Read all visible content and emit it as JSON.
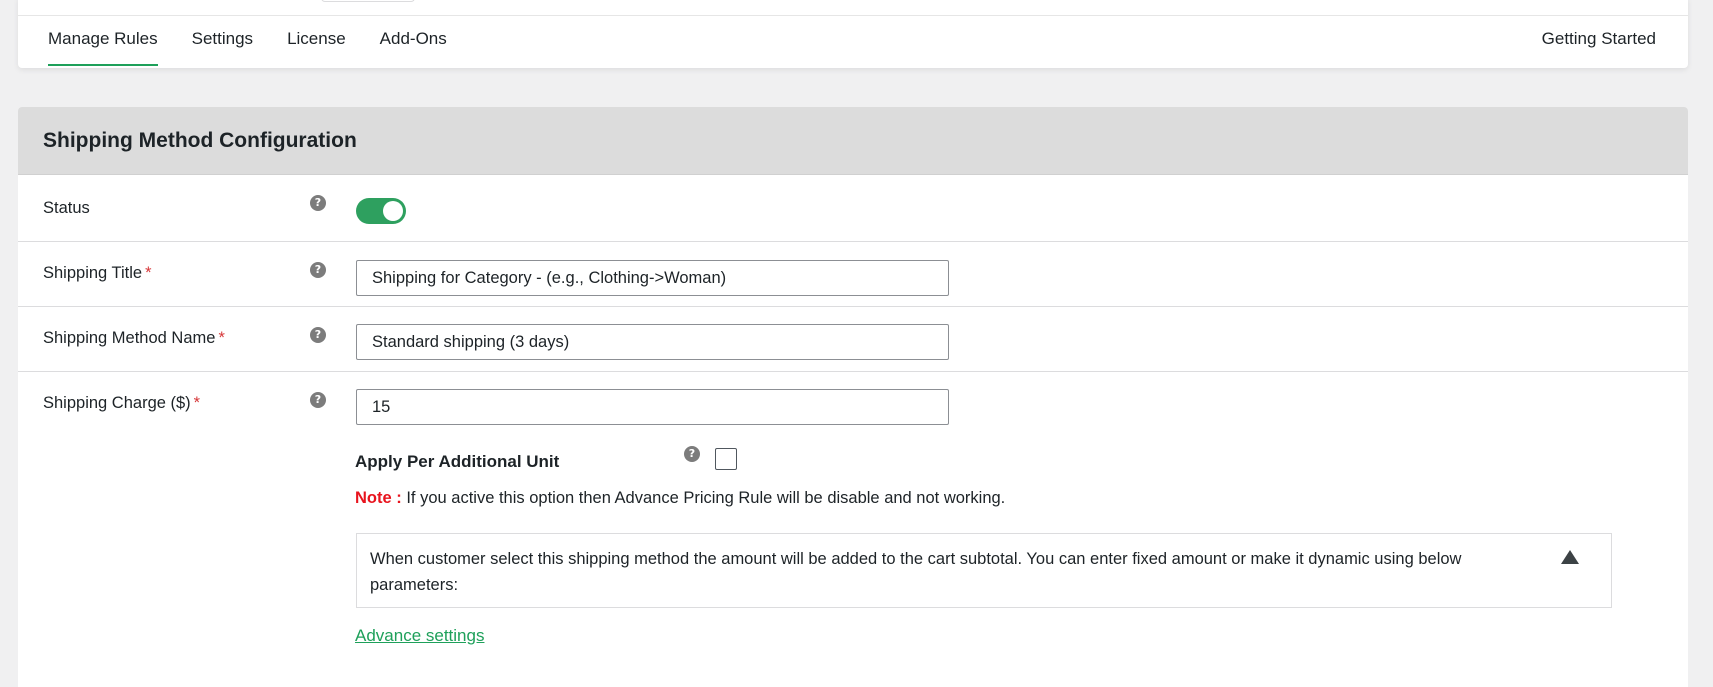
{
  "nav": {
    "tabs": [
      {
        "label": "Manage Rules",
        "active": true
      },
      {
        "label": "Settings",
        "active": false
      },
      {
        "label": "License",
        "active": false
      },
      {
        "label": "Add-Ons",
        "active": false
      }
    ],
    "right_link": "Getting Started"
  },
  "config": {
    "title": "Shipping Method Configuration",
    "status": {
      "label": "Status",
      "enabled": true
    },
    "shipping_title": {
      "label": "Shipping Title",
      "required_mark": "*",
      "value": "Shipping for Category - (e.g., Clothing->Woman)"
    },
    "method_name": {
      "label": "Shipping Method Name",
      "required_mark": "*",
      "value": "Standard shipping (3 days)"
    },
    "charge": {
      "label": "Shipping Charge ($)",
      "required_mark": "*",
      "value": "15",
      "apply_per_unit_label": "Apply Per Additional Unit",
      "apply_per_unit_checked": false,
      "note_label": "Note :",
      "note_text": " If you active this option then Advance Pricing Rule will be disable and not working.",
      "info_text": "When customer select this shipping method the amount will be added to the cart subtotal. You can enter fixed amount or make it dynamic using below parameters:",
      "advance_link": "Advance settings"
    },
    "help_glyph": "?"
  },
  "colors": {
    "accent": "#1ea05a",
    "toggle_on": "#2ea05f",
    "required": "#d63638",
    "note": "#e8141e",
    "header_bg": "#dcdcdc",
    "page_bg": "#f0f0f1"
  },
  "icons": [
    "help-icon",
    "collapse-arrow-icon"
  ]
}
